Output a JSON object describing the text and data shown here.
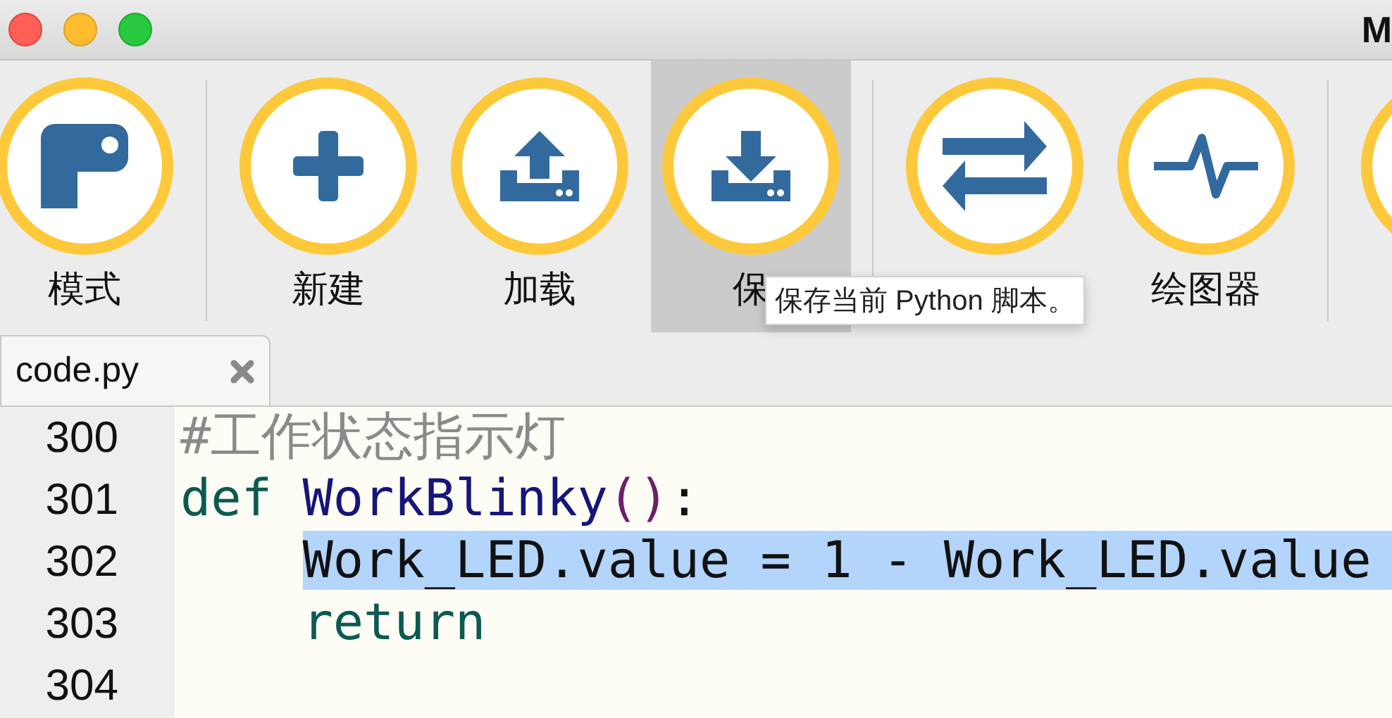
{
  "window": {
    "title": "M"
  },
  "toolbar": {
    "groups": [
      [
        {
          "kind": "mode",
          "label": "模式",
          "selected": false
        }
      ],
      [
        {
          "kind": "new",
          "label": "新建",
          "selected": false
        },
        {
          "kind": "load",
          "label": "加载",
          "selected": false
        },
        {
          "kind": "save",
          "label": "保",
          "selected": true
        }
      ],
      [
        {
          "kind": "serial",
          "selected": false
        },
        {
          "kind": "plotter",
          "label": "绘图器",
          "selected": false
        }
      ],
      [
        {
          "kind": "partial",
          "selected": false
        }
      ]
    ]
  },
  "tooltip": {
    "text": "保存当前 Python 脚本。"
  },
  "tabs": [
    {
      "label": "code.py"
    }
  ],
  "editor": {
    "lines": [
      {
        "number": "300",
        "selected": false,
        "indented": false,
        "tokens": [
          {
            "kind": "comment",
            "text": "#工作状态指示灯",
            "space_before": false
          }
        ]
      },
      {
        "number": "301",
        "selected": false,
        "indented": false,
        "tokens": [
          {
            "kind": "keyword",
            "text": "def",
            "space_before": false
          },
          {
            "kind": "name",
            "text": "WorkBlinky",
            "space_before": true
          },
          {
            "kind": "punct",
            "text": "()",
            "space_before": false
          },
          {
            "kind": "plain",
            "text": ":",
            "space_before": false
          }
        ]
      },
      {
        "number": "302",
        "selected": true,
        "indented": true,
        "tokens": [
          {
            "kind": "plain",
            "text": "Work_LED.value = 1 - Work_LED.value",
            "space_before": false
          }
        ]
      },
      {
        "number": "303",
        "selected": false,
        "indented": true,
        "tokens": [
          {
            "kind": "keyword",
            "text": "return",
            "space_before": false
          }
        ]
      },
      {
        "number": "304",
        "selected": false
      }
    ]
  }
}
